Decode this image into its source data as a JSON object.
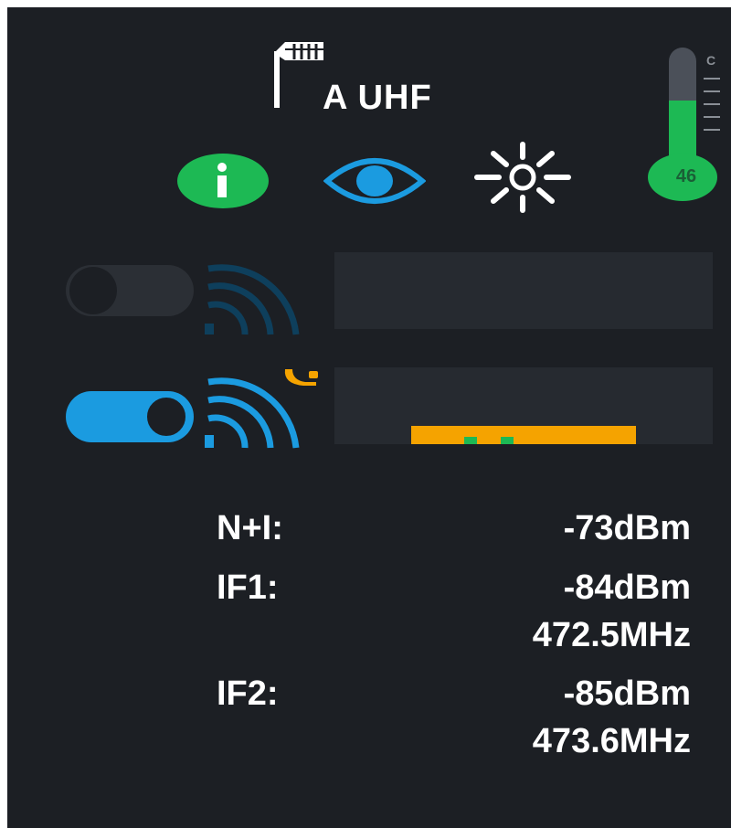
{
  "header": {
    "channel_label": "A UHF",
    "antenna_icon": "antenna-icon"
  },
  "thermometer": {
    "value": "46",
    "unit": "C",
    "level_fraction": 0.6,
    "fill_color": "#1db954",
    "empty_color": "#4b5059"
  },
  "icons": {
    "info": "info-icon",
    "monitor": "eye-icon",
    "brightness": "brightness-icon"
  },
  "receivers": [
    {
      "enabled": false,
      "signal_color": "#0e3f5c",
      "active_alert": false
    },
    {
      "enabled": true,
      "signal_color": "#1b9be0",
      "active_alert": true,
      "alert_color": "#f5a300",
      "meter": {
        "level_color": "#f5a300",
        "peak_color": "#1db954"
      }
    }
  ],
  "stats": {
    "ni_label": "N+I:",
    "ni_value": "-73dBm",
    "if1_label": "IF1:",
    "if1_value": "-84dBm",
    "if1_freq": "472.5MHz",
    "if2_label": "IF2:",
    "if2_value": "-85dBm",
    "if2_freq": "473.6MHz"
  },
  "colors": {
    "background": "#1c1f24",
    "accent_blue": "#1b9be0",
    "accent_green": "#1db954",
    "accent_orange": "#f5a300"
  }
}
